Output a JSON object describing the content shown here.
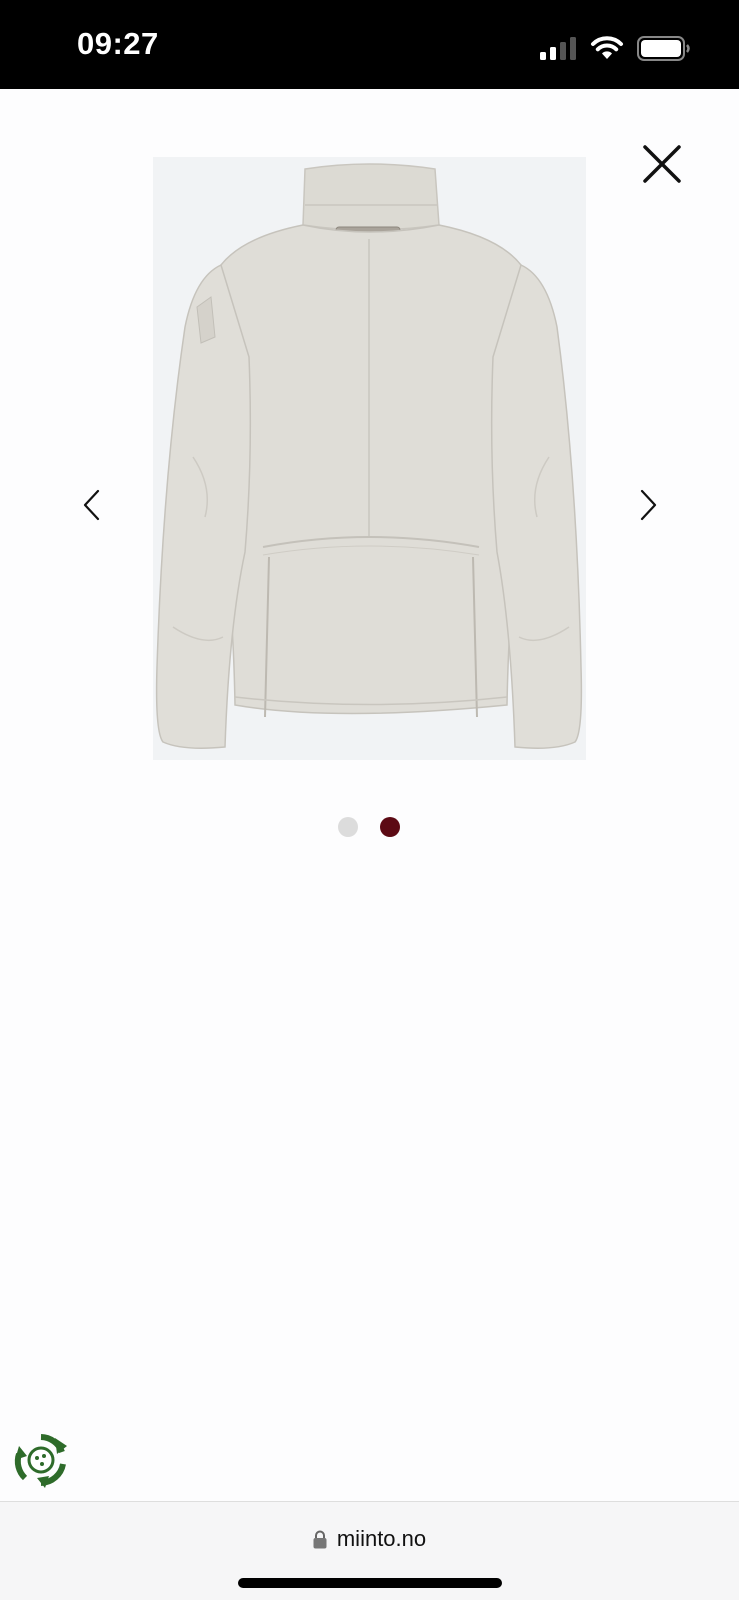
{
  "status_bar": {
    "time": "09:27",
    "signal_icon": "cellular-signal-icon",
    "wifi_icon": "wifi-icon",
    "battery_icon": "battery-icon"
  },
  "viewer": {
    "close_icon": "close-icon",
    "prev_icon": "chevron-left-icon",
    "next_icon": "chevron-right-icon",
    "image_subject": "jacket-back-view",
    "image_count": 2,
    "active_index": 2,
    "colors": {
      "jacket": "#dedcd6",
      "image_bg": "#f1f3f5",
      "dot_inactive": "#dcdcdc",
      "dot_active": "#5c0a14"
    }
  },
  "eco_badge": {
    "icon": "recycle-logo-icon",
    "color": "#2e6b2a"
  },
  "browser_bar": {
    "lock_icon": "lock-icon",
    "url": "miinto.no"
  }
}
